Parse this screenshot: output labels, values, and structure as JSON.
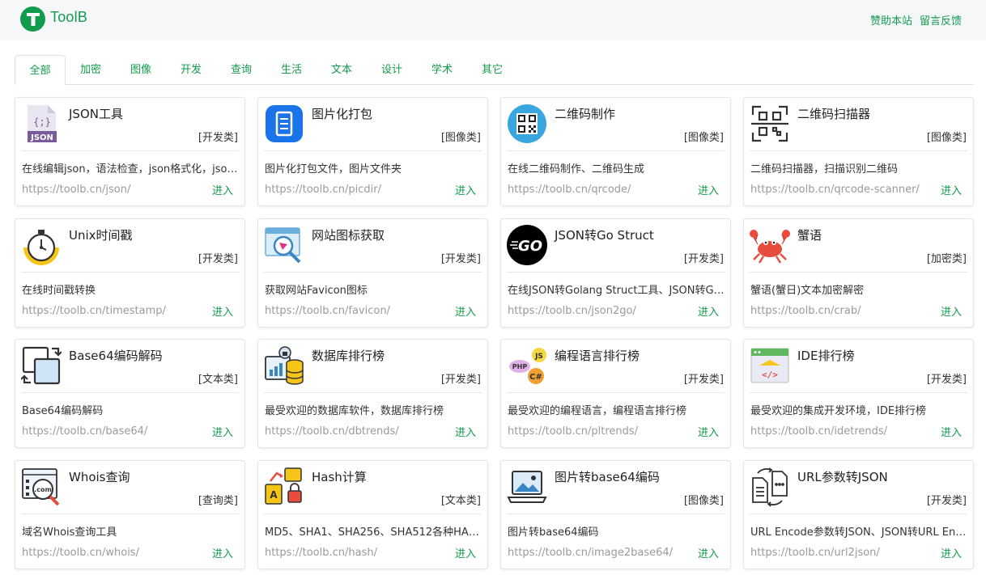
{
  "header": {
    "brand": "ToolB",
    "links": [
      "赞助本站",
      "留言反馈"
    ]
  },
  "tabs": [
    "全部",
    "加密",
    "图像",
    "开发",
    "查询",
    "生活",
    "文本",
    "设计",
    "学术",
    "其它"
  ],
  "active_tab": "全部",
  "enter_label": "进入",
  "cards": [
    {
      "title": "JSON工具",
      "category": "[开发类]",
      "desc": "在线编辑json，语法检查，json格式化，json…",
      "url": "https://toolb.cn/json/",
      "icon": "json-file-icon"
    },
    {
      "title": "图片化打包",
      "category": "[图像类]",
      "desc": "图片化打包文件，图片文件夹",
      "url": "https://toolb.cn/picdir/",
      "icon": "document-icon"
    },
    {
      "title": "二维码制作",
      "category": "[图像类]",
      "desc": "在线二维码制作、二维码生成",
      "url": "https://toolb.cn/qrcode/",
      "icon": "qrcode-icon"
    },
    {
      "title": "二维码扫描器",
      "category": "[图像类]",
      "desc": "二维码扫描器，扫描识别二维码",
      "url": "https://toolb.cn/qrcode-scanner/",
      "icon": "qr-scanner-icon"
    },
    {
      "title": "Unix时间戳",
      "category": "[开发类]",
      "desc": "在线时间戳转换",
      "url": "https://toolb.cn/timestamp/",
      "icon": "stopwatch-icon"
    },
    {
      "title": "网站图标获取",
      "category": "[开发类]",
      "desc": "获取网站Favicon图标",
      "url": "https://toolb.cn/favicon/",
      "icon": "favicon-search-icon"
    },
    {
      "title": "JSON转Go Struct",
      "category": "[开发类]",
      "desc": "在线JSON转Golang Struct工具、JSON转Go…",
      "url": "https://toolb.cn/json2go/",
      "icon": "go-logo-icon"
    },
    {
      "title": "蟹语",
      "category": "[加密类]",
      "desc": "蟹语(蟹日)文本加密解密",
      "url": "https://toolb.cn/crab/",
      "icon": "crab-icon"
    },
    {
      "title": "Base64编码解码",
      "category": "[文本类]",
      "desc": "Base64编码解码",
      "url": "https://toolb.cn/base64/",
      "icon": "convert-arrows-icon"
    },
    {
      "title": "数据库排行榜",
      "category": "[开发类]",
      "desc": "最受欢迎的数据库软件，数据库排行榜",
      "url": "https://toolb.cn/dbtrends/",
      "icon": "database-icon"
    },
    {
      "title": "编程语言排行榜",
      "category": "[开发类]",
      "desc": "最受欢迎的编程语言，编程语言排行榜",
      "url": "https://toolb.cn/pltrends/",
      "icon": "languages-icon"
    },
    {
      "title": "IDE排行榜",
      "category": "[开发类]",
      "desc": "最受欢迎的集成开发环境，IDE排行榜",
      "url": "https://toolb.cn/idetrends/",
      "icon": "ide-code-icon"
    },
    {
      "title": "Whois查询",
      "category": "[查询类]",
      "desc": "域名Whois查询工具",
      "url": "https://toolb.cn/whois/",
      "icon": "domain-search-icon"
    },
    {
      "title": "Hash计算",
      "category": "[文本类]",
      "desc": "MD5、SHA1、SHA256、SHA512各种HA…",
      "url": "https://toolb.cn/hash/",
      "icon": "hash-lock-icon"
    },
    {
      "title": "图片转base64编码",
      "category": "[图像类]",
      "desc": "图片转base64编码",
      "url": "https://toolb.cn/image2base64/",
      "icon": "laptop-image-icon"
    },
    {
      "title": "URL参数转JSON",
      "category": "[开发类]",
      "desc": "URL Encode参数转JSON、JSON转URL En…",
      "url": "https://toolb.cn/url2json/",
      "icon": "file-convert-icon"
    }
  ],
  "colors": {
    "accent": "#119b4c",
    "url_gray": "#9a9a9a"
  },
  "icon_text": {
    "json": "JSON",
    "json_braces": "{;}",
    "go": "GO",
    "com": ".com",
    "php": "PHP",
    "js": "JS",
    "csharp": "C#",
    "code": "</>"
  }
}
